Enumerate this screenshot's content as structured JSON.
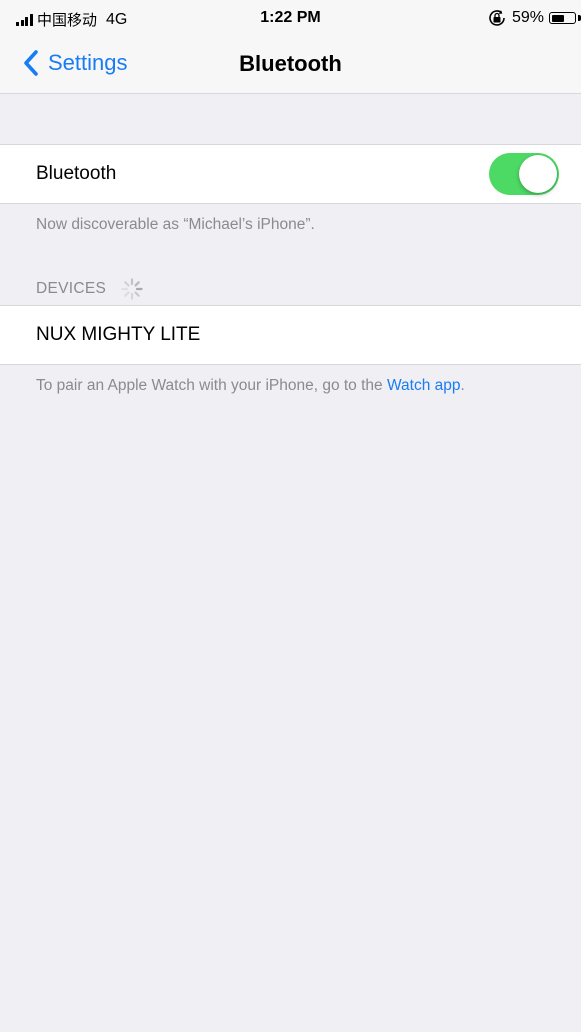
{
  "status_bar": {
    "carrier": "中国移动",
    "network": "4G",
    "time": "1:22 PM",
    "battery_percent": "59%",
    "battery_level": 0.59
  },
  "nav": {
    "back_label": "Settings",
    "title": "Bluetooth"
  },
  "bluetooth": {
    "label": "Bluetooth",
    "enabled": true,
    "discoverable_text": "Now discoverable as “Michael’s iPhone”."
  },
  "devices": {
    "header": "DEVICES",
    "items": [
      {
        "name": "NUX MIGHTY LITE"
      }
    ]
  },
  "footer": {
    "text": "To pair an Apple Watch with your iPhone, go to the ",
    "link_label": "Watch app",
    "text_end": "."
  },
  "colors": {
    "accent": "#1a7cf5",
    "toggle_on": "#4cd964",
    "background": "#efeff4",
    "secondary_text": "#8a8a8f"
  },
  "icons": {
    "back": "chevron-left-icon",
    "spinner": "spinner-icon",
    "rotation_lock": "rotation-lock-icon",
    "signal": "signal-icon",
    "battery": "battery-icon"
  }
}
